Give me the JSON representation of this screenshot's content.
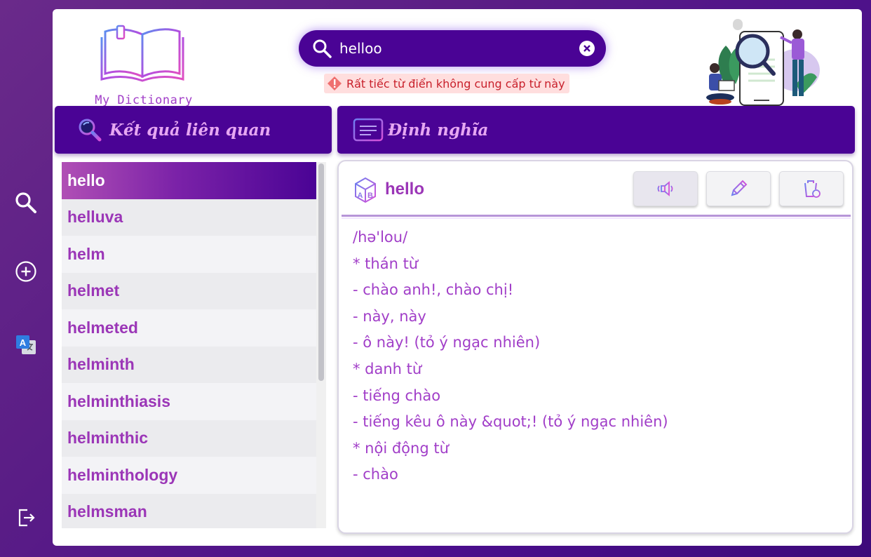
{
  "app": {
    "logo_text": "My Dictionary"
  },
  "sidebar": {
    "items": [
      {
        "icon": "search-icon"
      },
      {
        "icon": "add-circle-icon"
      },
      {
        "icon": "translate-icon"
      },
      {
        "icon": "logout-icon"
      }
    ]
  },
  "search": {
    "value": "helloo",
    "placeholder": ""
  },
  "warning": {
    "text": "Rất tiếc từ điển không cung cấp từ này"
  },
  "related_panel": {
    "title": "Kết quả liên quan",
    "words": [
      "hello",
      "helluva",
      "helm",
      "helmet",
      "helmeted",
      "helminth",
      "helminthiasis",
      "helminthic",
      "helminthology",
      "helmsman"
    ],
    "selected_index": 0
  },
  "definition_panel": {
    "title": "Định nghĩa",
    "word": "hello",
    "lines": [
      "/hə'lou/",
      "* thán từ",
      "- chào anh!, chào chị!",
      "- này, này",
      "- ô này! (tỏ ý ngạc nhiên)",
      "* danh từ",
      "- tiếng chào",
      "- tiếng kêu ô này &quot;! (tỏ ý ngạc nhiên)",
      "* nội động từ",
      "- chào"
    ],
    "tools": [
      "speaker-icon",
      "pencil-icon",
      "delete-icon"
    ]
  },
  "colors": {
    "primary": "#4a0395",
    "accent": "#9b36b7",
    "header_text": "#e6a7f2",
    "warning_bg": "#ffdede",
    "warning_text": "#c8202b"
  }
}
